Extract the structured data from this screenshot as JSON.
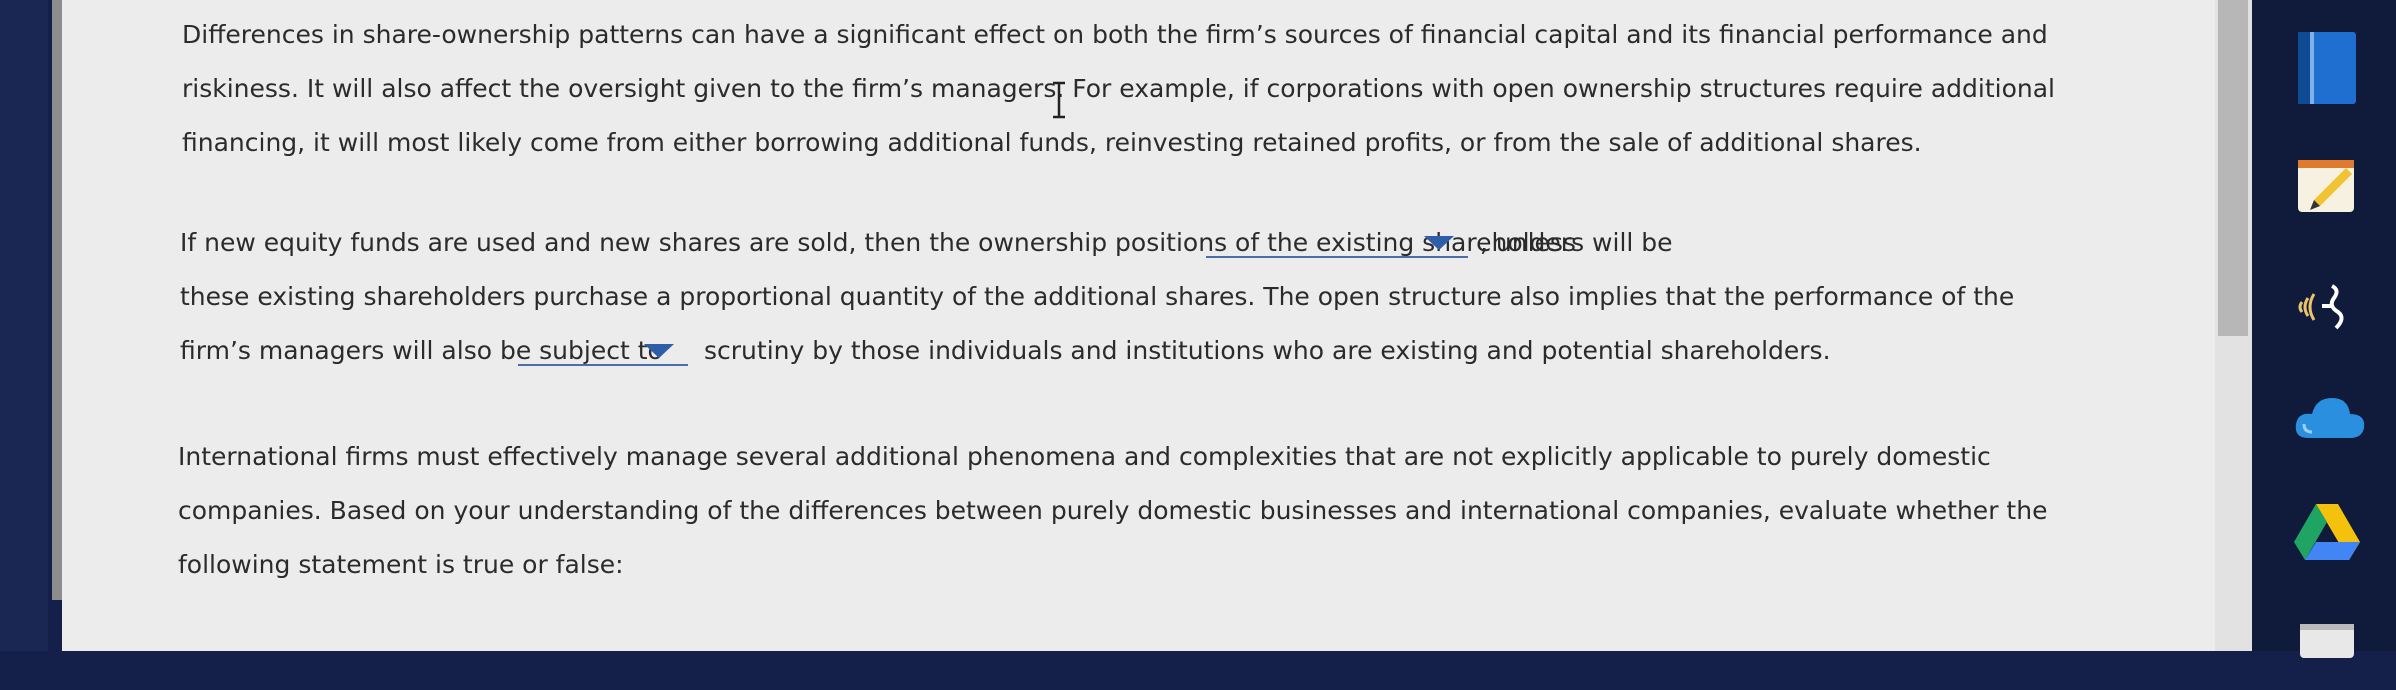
{
  "paragraph1": {
    "line1": "Differences in share-ownership patterns can have a significant effect on both the firm’s sources of financial capital and its financial performance and",
    "line2": "riskiness. It will also affect the oversight given to the firm’s managers. For example, if corporations with open ownership structures require additional",
    "line3": "financing, it will most likely come from either borrowing additional funds, reinvesting retained profits, or from the sale of additional shares."
  },
  "paragraph2": {
    "line1_before": "If new equity funds are used and new shares are sold, then the ownership positions of the existing shareholders will be",
    "line1_after": ", unless",
    "line2": "these existing shareholders purchase a proportional quantity of the additional shares. The open structure also implies that the performance of the",
    "line3_before": "firm’s managers will also be subject to",
    "line3_after": "scrutiny by those individuals and institutions who are existing and potential shareholders.",
    "dropdown1_value": "",
    "dropdown2_value": ""
  },
  "paragraph3": {
    "line1": "International firms must effectively manage several additional phenomena and complexities that are not explicitly applicable to purely domestic",
    "line2": "companies. Based on your understanding of the differences between purely domestic businesses and international companies, evaluate whether the",
    "line3": "following statement is true or false:"
  },
  "dock": {
    "icons": [
      "book-icon",
      "notepad-icon",
      "wifi-tool-icon",
      "cloud-icon",
      "drive-icon",
      "app-icon-partial"
    ]
  },
  "colors": {
    "page_bg": "#ececec",
    "text": "#2b2b2b",
    "dropdown_accent": "#2f5ea8",
    "dock_bg": "#101a3a"
  }
}
